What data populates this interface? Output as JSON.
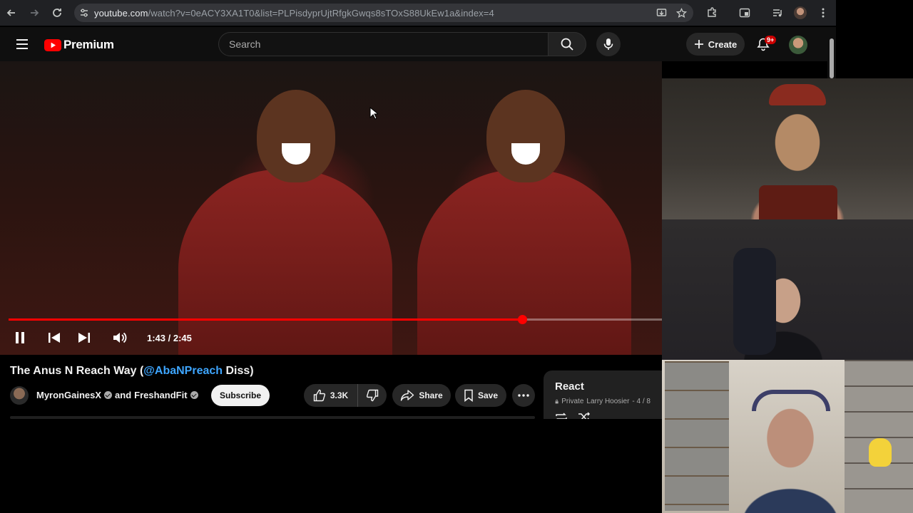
{
  "browser": {
    "url_host": "youtube.com",
    "url_rest": "/watch?v=0eACY3XA1T0&list=PLPisdyprUjtRfgkGwqs8sTOxS88UkEw1a&index=4"
  },
  "header": {
    "logo_text": "Premium",
    "search_placeholder": "Search",
    "create_label": "Create",
    "notification_count": "9+"
  },
  "player": {
    "timecode": "1:43 / 2:45",
    "progress_fraction": 0.7863
  },
  "video": {
    "title_prefix": "The Anus N Reach Way (",
    "title_mention": "@AbaNPreach",
    "title_suffix": " Diss)",
    "channel_1": "MyronGainesX",
    "channel_joiner": "and",
    "channel_2": "FreshandFit",
    "subscribe_label": "Subscribe",
    "like_count": "3.3K",
    "share_label": "Share",
    "save_label": "Save"
  },
  "playlist": {
    "title": "React",
    "visibility": "Private",
    "owner": "Larry Hoosier",
    "position": "- 4 / 8"
  },
  "colors": {
    "accent_red": "#ff0000",
    "mention_blue": "#3ea6ff",
    "background": "#0f0f0f"
  },
  "icons": [
    "back-icon",
    "forward-icon",
    "reload-icon",
    "site-info-icon",
    "install-icon",
    "star-icon",
    "extensions-icon",
    "sidepanel-icon",
    "media-icon",
    "profile-icon",
    "menu-dots-icon",
    "hamburger-icon",
    "youtube-logo-icon",
    "search-icon",
    "mic-icon",
    "plus-icon",
    "bell-icon",
    "pause-icon",
    "previous-icon",
    "next-icon",
    "volume-icon",
    "thumbs-up-icon",
    "thumbs-down-icon",
    "share-icon",
    "bookmark-icon",
    "more-icon",
    "lock-icon",
    "loop-icon",
    "shuffle-icon"
  ]
}
